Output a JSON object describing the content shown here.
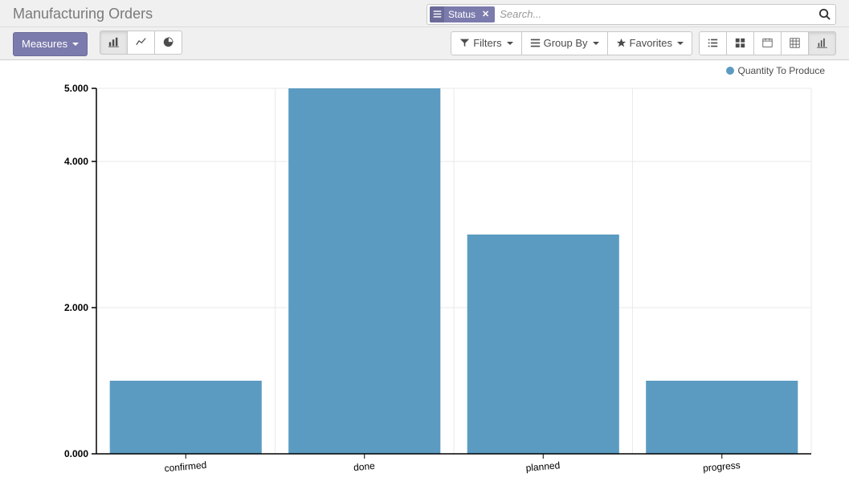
{
  "header": {
    "title": "Manufacturing Orders"
  },
  "search": {
    "facet_label": "Status",
    "placeholder": "Search..."
  },
  "toolbar": {
    "measures_label": "Measures",
    "filters_label": "Filters",
    "groupby_label": "Group By",
    "favorites_label": "Favorites"
  },
  "legend": {
    "series_name": "Quantity To Produce",
    "color": "#5b9bc1"
  },
  "chart_data": {
    "type": "bar",
    "categories": [
      "confirmed",
      "done",
      "planned",
      "progress"
    ],
    "values": [
      1.0,
      5.0,
      3.0,
      1.0
    ],
    "title": "",
    "xlabel": "",
    "ylabel": "",
    "ylim": [
      0,
      5
    ],
    "yticks": [
      "0.000",
      "2.000",
      "4.000",
      "5.000"
    ],
    "series": [
      {
        "name": "Quantity To Produce",
        "color": "#5b9bc1",
        "values": [
          1.0,
          5.0,
          3.0,
          1.0
        ]
      }
    ]
  }
}
